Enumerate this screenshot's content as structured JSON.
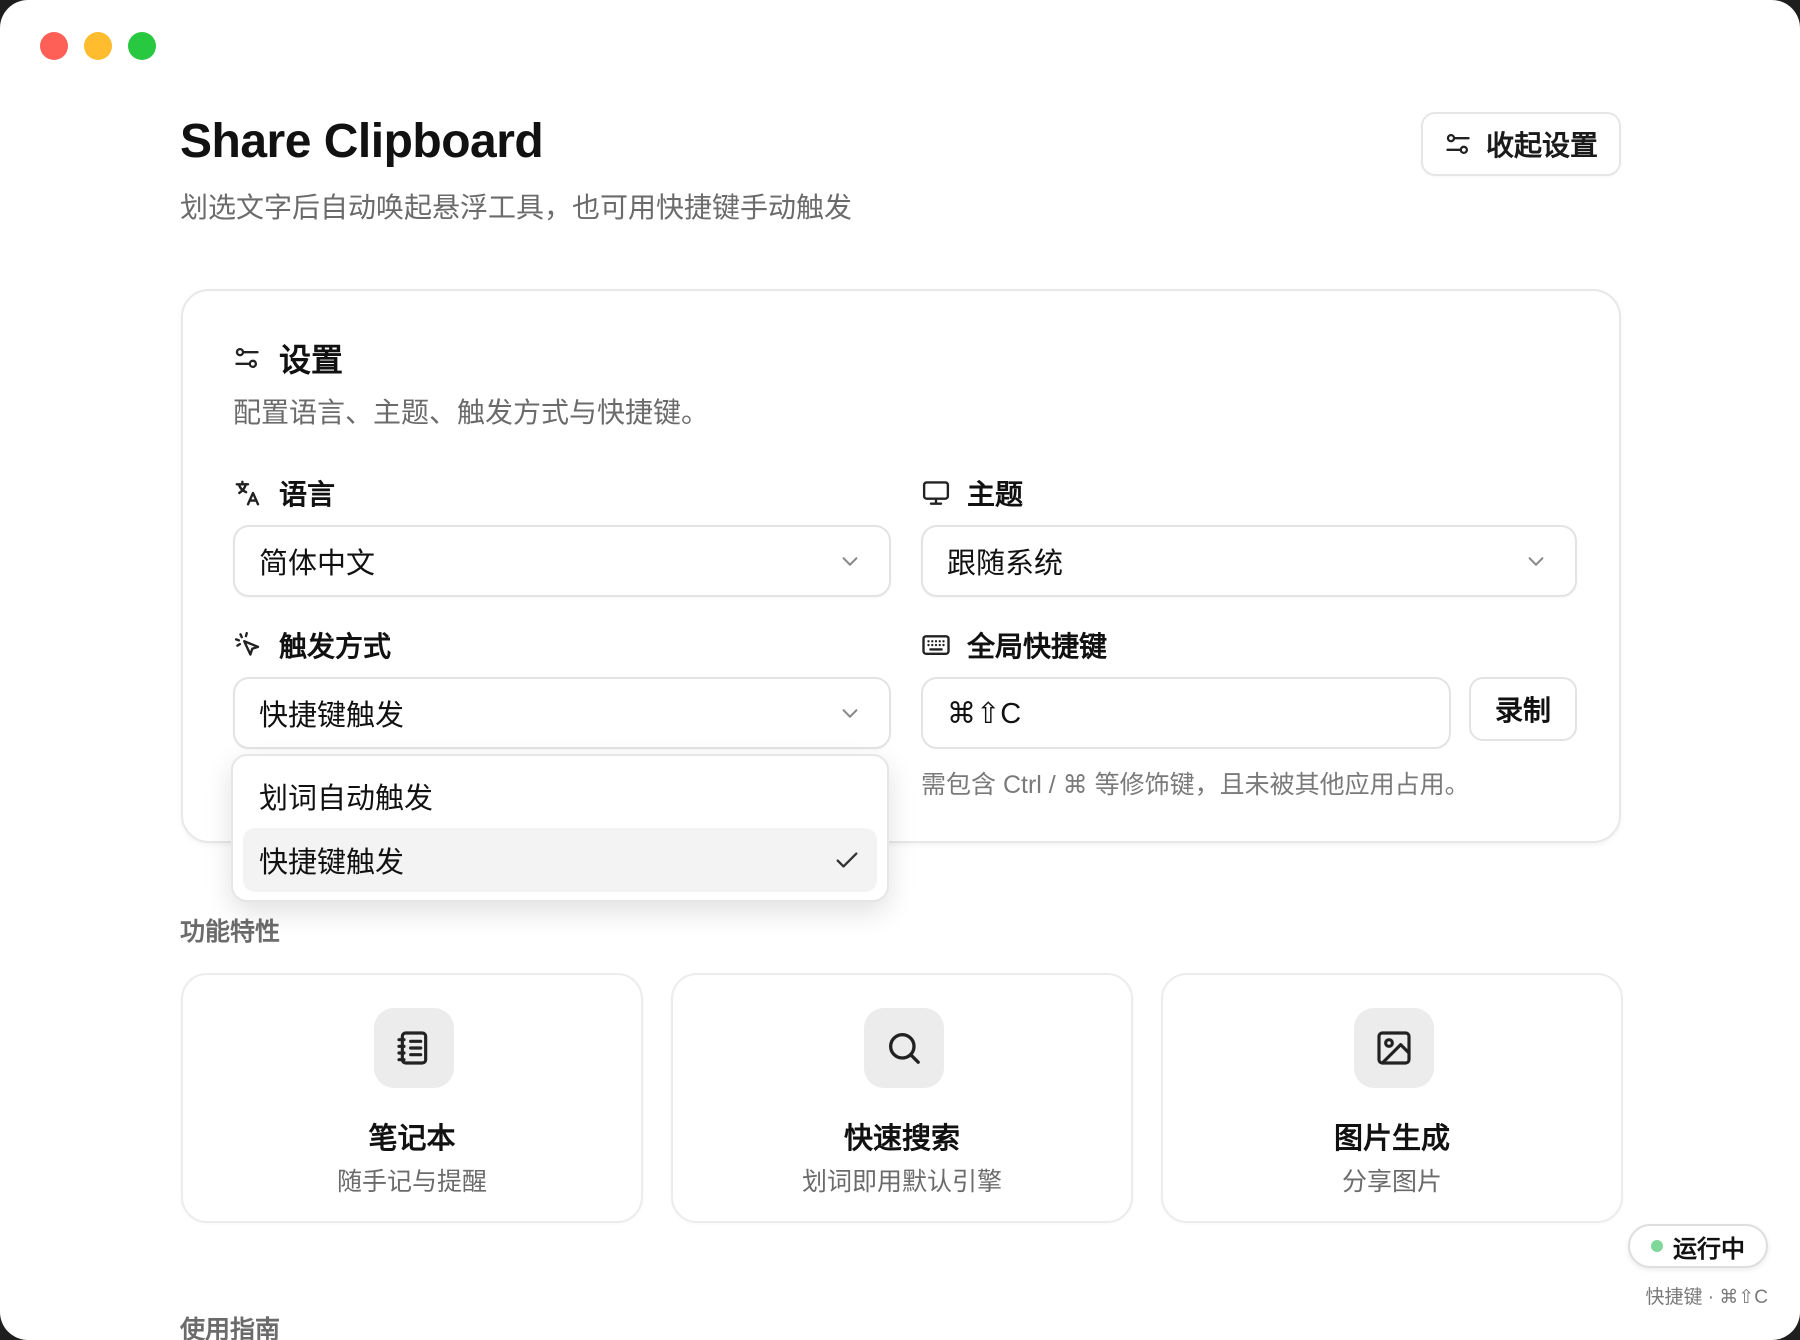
{
  "app": {
    "title": "Share Clipboard",
    "subtitle": "划选文字后自动唤起悬浮工具，也可用快捷键手动触发",
    "collapse_button": "收起设置"
  },
  "colors": {
    "close": "#fe5f57",
    "minimize": "#febc2e",
    "maximize": "#28c840",
    "status_dot": "#7fd89a"
  },
  "settings": {
    "title": "设置",
    "description": "配置语言、主题、触发方式与快捷键。",
    "language": {
      "label": "语言",
      "value": "简体中文",
      "icon": "translate-icon"
    },
    "theme": {
      "label": "主题",
      "value": "跟随系统",
      "icon": "monitor-icon"
    },
    "trigger": {
      "label": "触发方式",
      "value": "快捷键触发",
      "icon": "pointer-click-icon",
      "options": [
        {
          "label": "划词自动触发",
          "selected": false
        },
        {
          "label": "快捷键触发",
          "selected": true
        }
      ]
    },
    "hotkey": {
      "label": "全局快捷键",
      "value": "⌘⇧C",
      "record_button": "录制",
      "hint": "需包含 Ctrl / ⌘ 等修饰键，且未被其他应用占用。",
      "icon": "keyboard-icon"
    }
  },
  "features": {
    "heading": "功能特性",
    "items": [
      {
        "title": "笔记本",
        "desc": "随手记与提醒",
        "icon": "notebook-icon"
      },
      {
        "title": "快速搜索",
        "desc": "划词即用默认引擎",
        "icon": "search-icon"
      },
      {
        "title": "图片生成",
        "desc": "分享图片",
        "icon": "image-icon"
      }
    ]
  },
  "guide": {
    "heading": "使用指南"
  },
  "status": {
    "label": "运行中",
    "shortcut": "快捷键 · ⌘⇧C"
  }
}
